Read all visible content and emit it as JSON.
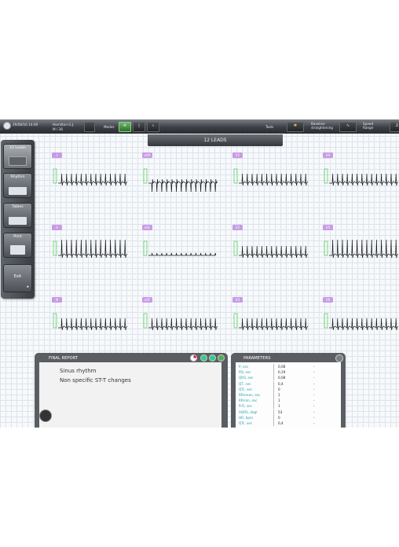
{
  "topbar": {
    "datetime": "29/08/16 14:49",
    "patient_name": "Hamilton G.J.",
    "patient_info": "M / 36",
    "modes_label": "Modes",
    "tools_label": "Tools",
    "baseline_label": "Baseline straightening",
    "speed_label": "Speed Range",
    "speed_value": "2"
  },
  "view_title": "12 LEADS",
  "left_panel": [
    {
      "label": "12 Leads"
    },
    {
      "label": "Rhythm"
    },
    {
      "label": "Tables"
    },
    {
      "label": "Print"
    },
    {
      "label": "Exit"
    }
  ],
  "leads": [
    {
      "name": "I"
    },
    {
      "name": "aVR"
    },
    {
      "name": "V1"
    },
    {
      "name": "V4"
    },
    {
      "name": "II"
    },
    {
      "name": "aVL"
    },
    {
      "name": "V2"
    },
    {
      "name": "V5"
    },
    {
      "name": "III"
    },
    {
      "name": "aVF"
    },
    {
      "name": "V3"
    },
    {
      "name": "V6"
    }
  ],
  "report": {
    "title": "FINAL REPORT",
    "lines": [
      "Sinus rhythm",
      "Non specific ST-T changes"
    ]
  },
  "parameters": {
    "title": "PARAMETERS",
    "rows": [
      {
        "name": "P, sec",
        "value": "0,08",
        "dash": "-"
      },
      {
        "name": "PQ, sec",
        "value": "0,19",
        "dash": "-"
      },
      {
        "name": "QRS, sec",
        "value": "0,08",
        "dash": "-"
      },
      {
        "name": "QT, sec",
        "value": "0,4",
        "dash": "-"
      },
      {
        "name": "QTc, sec",
        "value": "0",
        "dash": "-"
      },
      {
        "name": "RRmean, sec",
        "value": "1",
        "dash": "-"
      },
      {
        "name": "RRmin, sec",
        "value": "1",
        "dash": "-"
      },
      {
        "name": "R-R, sec",
        "value": "1",
        "dash": "-"
      },
      {
        "name": "AQRS, degr",
        "value": "53",
        "dash": "-"
      },
      {
        "name": "HR, bpm",
        "value": "0",
        "dash": "-"
      },
      {
        "name": "QTc, sec",
        "value": "0,4",
        "dash": "-"
      }
    ]
  },
  "colors": {
    "lead_tag": "#c79be6",
    "calibration": "#5fd45f",
    "param_name": "#2a9fb3"
  }
}
